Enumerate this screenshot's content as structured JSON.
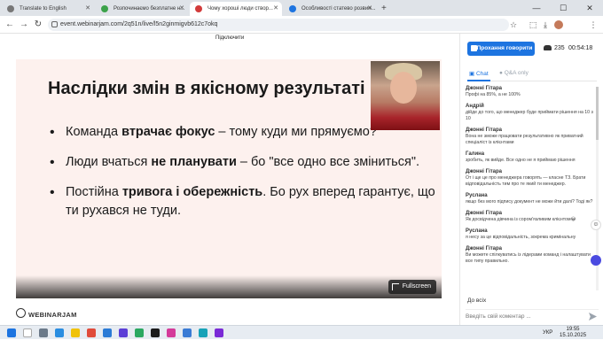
{
  "browser": {
    "tabs": [
      {
        "title": "Translate to English",
        "active": false,
        "favicon_color": "#777777"
      },
      {
        "title": "Розпочинаємо безплатне н...",
        "active": false,
        "favicon_color": "#3ca24a"
      },
      {
        "title": "Чому хороші люди створ...",
        "active": true,
        "favicon_color": "#d23b3b"
      },
      {
        "title": "Особливості статево розвин...",
        "active": false,
        "favicon_color": "#1d74e0"
      }
    ],
    "new_tab": "+",
    "url": "event.webinarjam.com/2q51n/live/l5n2ginmigvb612c7okq"
  },
  "page": {
    "reconnect": "Підключити",
    "slide": {
      "title": "Наслідки змін в якісному результаті",
      "bullets": [
        {
          "pre": "Команда ",
          "bold": "втрачає фокус",
          "post": " – тому куди ми прямуємо?"
        },
        {
          "pre": "Люди вчаться ",
          "bold": "не планувати",
          "post": " – бо \"все одно все зміниться\"."
        },
        {
          "pre": "Постійна ",
          "bold": "тривога і обережність",
          "post": ". Бо рух вперед гарантує, що ти рухався не туди."
        }
      ]
    },
    "fullscreen_label": "Fullscreen",
    "logo": "WEBINARJAM"
  },
  "sidebar": {
    "speak_button": "Прохання говорити",
    "viewer_count": "235",
    "timer": "00:54:18",
    "tabs": {
      "chat": "Chat",
      "qa": "Q&A only"
    },
    "messages": [
      {
        "author": "Джонні Гітара",
        "text": "Профі на 85%, а не 100%"
      },
      {
        "author": "Андрій",
        "text": "дійде до того, що менеджер буде приймати рішення на 10 з 10"
      },
      {
        "author": "Джонні Гітара",
        "text": "Вона не зможе працювати результативно як приватний спеціаліст із клієнтами"
      },
      {
        "author": "Галина",
        "text": "зробить, як вийде. Все одно не я приймаю рішення"
      },
      {
        "author": "Джонні Гітара",
        "text": "От і ще це про менеджера говорять — класне ТЗ. Брати відповідальність тим про те який ти менеджер."
      },
      {
        "author": "Руслана",
        "text": "якщо без мого підпису документ не може йти далі? Тоді як?"
      },
      {
        "author": "Джонні Гітара",
        "text": "Як досвідчена дівчина із сором'язливим клієнтом😂"
      },
      {
        "author": "Руслана",
        "text": "я несу за це відповідальність, зокрема кримінальну"
      },
      {
        "author": "Джонні Гітара",
        "text": "Ви можете спілкуватись із лідерами команд і налаштувати все типу правильно."
      }
    ],
    "to_all": "До всіх",
    "comment_placeholder": "Введіть свій коментар ..."
  },
  "taskbar": {
    "lang": "УКР",
    "time": "19:55",
    "date": "15.10.2025"
  },
  "colors": {
    "accent": "#1d74e0",
    "slide_bg": "#fdf1ee",
    "tabbar_bg": "#dfe3e8"
  }
}
